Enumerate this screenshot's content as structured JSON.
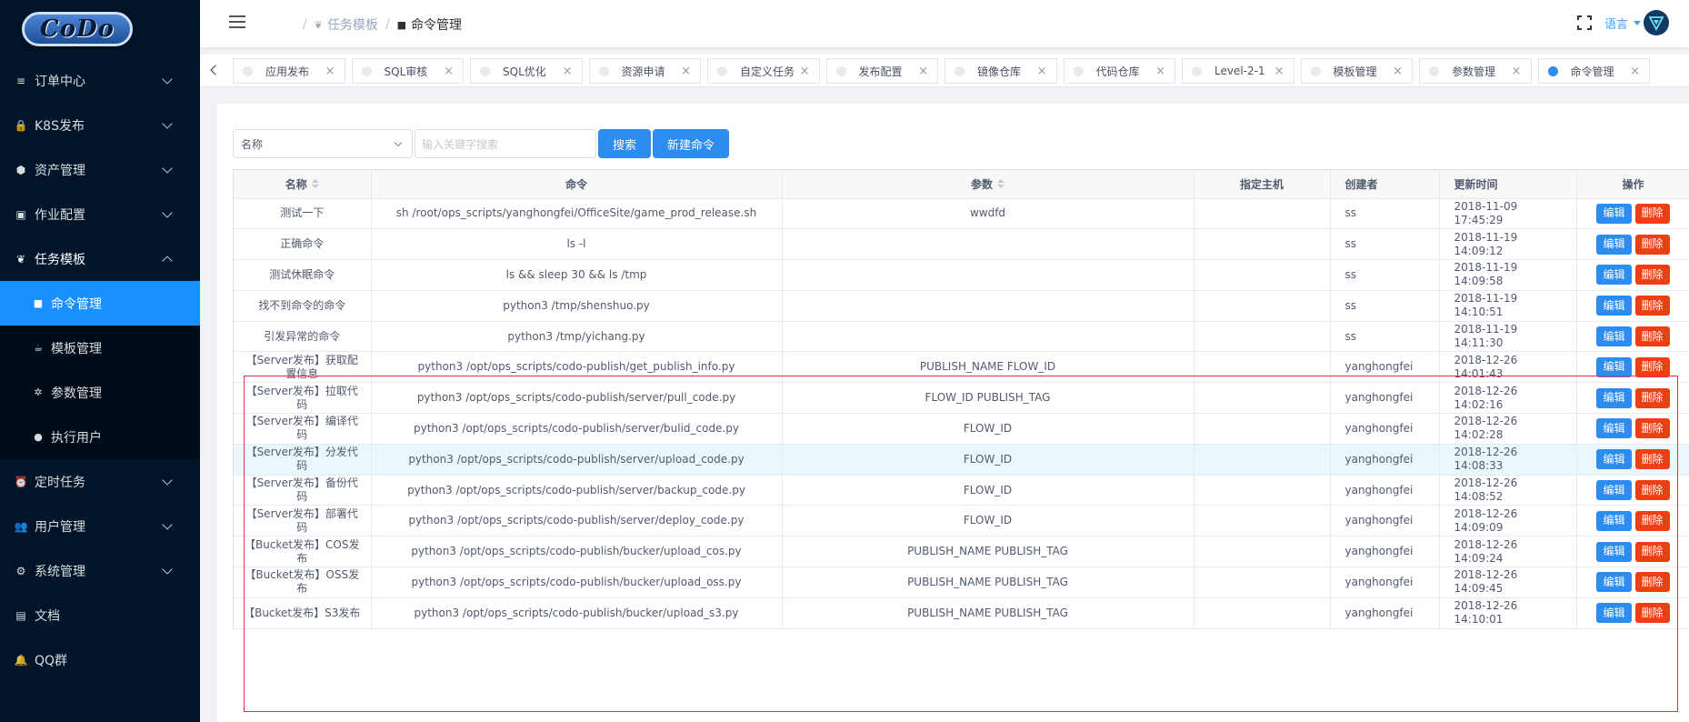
{
  "brand": {
    "logo_text": "CoDo"
  },
  "sidebar": {
    "items": [
      {
        "label": "订单中心",
        "icon": "list-icon",
        "expanded": false
      },
      {
        "label": "K8S发布",
        "icon": "lock-icon",
        "expanded": false
      },
      {
        "label": "资产管理",
        "icon": "cube-icon",
        "expanded": false
      },
      {
        "label": "作业配置",
        "icon": "briefcase-icon",
        "expanded": false
      },
      {
        "label": "任务模板",
        "icon": "leaf-icon",
        "expanded": true,
        "children": [
          {
            "label": "命令管理",
            "icon": "square-icon",
            "active": true
          },
          {
            "label": "模板管理",
            "icon": "cup-icon",
            "active": false
          },
          {
            "label": "参数管理",
            "icon": "asterisk-icon",
            "active": false
          },
          {
            "label": "执行用户",
            "icon": "user-circle-icon",
            "active": false
          }
        ]
      },
      {
        "label": "定时任务",
        "icon": "alarm-icon",
        "expanded": false
      },
      {
        "label": "用户管理",
        "icon": "users-icon",
        "expanded": false
      },
      {
        "label": "系统管理",
        "icon": "gear-icon",
        "expanded": false
      },
      {
        "label": "文档",
        "icon": "book-icon",
        "expanded": null
      },
      {
        "label": "QQ群",
        "icon": "bell-icon",
        "expanded": null
      }
    ]
  },
  "header": {
    "breadcrumb": {
      "parent": "任务模板",
      "current": "命令管理"
    },
    "language": "语言",
    "accent_color": "#409eff"
  },
  "tabs": [
    {
      "label": "应用发布",
      "active": false
    },
    {
      "label": "SQL审核",
      "active": false
    },
    {
      "label": "SQL优化",
      "active": false
    },
    {
      "label": "资源申请",
      "active": false
    },
    {
      "label": "自定义任务",
      "active": false
    },
    {
      "label": "发布配置",
      "active": false
    },
    {
      "label": "镜像仓库",
      "active": false
    },
    {
      "label": "代码仓库",
      "active": false
    },
    {
      "label": "Level-2-1",
      "active": false
    },
    {
      "label": "模板管理",
      "active": false
    },
    {
      "label": "参数管理",
      "active": false
    },
    {
      "label": "命令管理",
      "active": true
    }
  ],
  "toolbar": {
    "filter_select": "名称",
    "search_placeholder": "输入关键字搜索",
    "search_button": "搜索",
    "new_button": "新建命令"
  },
  "table": {
    "columns": [
      "名称",
      "命令",
      "参数",
      "指定主机",
      "创建者",
      "更新时间",
      "操作"
    ],
    "edit_label": "编辑",
    "delete_label": "删除",
    "rows": [
      {
        "name": "测试一下",
        "command": "sh /root/ops_scripts/yanghongfei/OfficeSite/game_prod_release.sh",
        "params": "wwdfd",
        "host": "",
        "creator": "ss",
        "updated": "2018-11-09 17:45:29"
      },
      {
        "name": "正确命令",
        "command": "ls -l",
        "params": "",
        "host": "",
        "creator": "ss",
        "updated": "2018-11-19 14:09:12"
      },
      {
        "name": "测试休眠命令",
        "command": "ls && sleep 30 && ls /tmp",
        "params": "",
        "host": "",
        "creator": "ss",
        "updated": "2018-11-19 14:09:58"
      },
      {
        "name": "找不到命令的命令",
        "command": "python3 /tmp/shenshuo.py",
        "params": "",
        "host": "",
        "creator": "ss",
        "updated": "2018-11-19 14:10:51"
      },
      {
        "name": "引发异常的命令",
        "command": "python3 /tmp/yichang.py",
        "params": "",
        "host": "",
        "creator": "ss",
        "updated": "2018-11-19 14:11:30"
      },
      {
        "name": "【Server发布】获取配置信息",
        "command": "python3 /opt/ops_scripts/codo-publish/get_publish_info.py",
        "params": "PUBLISH_NAME FLOW_ID",
        "host": "",
        "creator": "yanghongfei",
        "updated": "2018-12-26 14:01:43"
      },
      {
        "name": "【Server发布】拉取代码",
        "command": "python3 /opt/ops_scripts/codo-publish/server/pull_code.py",
        "params": "FLOW_ID PUBLISH_TAG",
        "host": "",
        "creator": "yanghongfei",
        "updated": "2018-12-26 14:02:16"
      },
      {
        "name": "【Server发布】编译代码",
        "command": "python3 /opt/ops_scripts/codo-publish/server/bulid_code.py",
        "params": "FLOW_ID",
        "host": "",
        "creator": "yanghongfei",
        "updated": "2018-12-26 14:02:28"
      },
      {
        "name": "【Server发布】分发代码",
        "command": "python3 /opt/ops_scripts/codo-publish/server/upload_code.py",
        "params": "FLOW_ID",
        "host": "",
        "creator": "yanghongfei",
        "updated": "2018-12-26 14:08:33",
        "hover": true
      },
      {
        "name": "【Server发布】备份代码",
        "command": "python3 /opt/ops_scripts/codo-publish/server/backup_code.py",
        "params": "FLOW_ID",
        "host": "",
        "creator": "yanghongfei",
        "updated": "2018-12-26 14:08:52"
      },
      {
        "name": "【Server发布】部署代码",
        "command": "python3 /opt/ops_scripts/codo-publish/server/deploy_code.py",
        "params": "FLOW_ID",
        "host": "",
        "creator": "yanghongfei",
        "updated": "2018-12-26 14:09:09"
      },
      {
        "name": "【Bucket发布】COS发布",
        "command": "python3 /opt/ops_scripts/codo-publish/bucker/upload_cos.py",
        "params": "PUBLISH_NAME PUBLISH_TAG",
        "host": "",
        "creator": "yanghongfei",
        "updated": "2018-12-26 14:09:24"
      },
      {
        "name": "【Bucket发布】OSS发布",
        "command": "python3 /opt/ops_scripts/codo-publish/bucker/upload_oss.py",
        "params": "PUBLISH_NAME PUBLISH_TAG",
        "host": "",
        "creator": "yanghongfei",
        "updated": "2018-12-26 14:09:45"
      },
      {
        "name": "【Bucket发布】S3发布",
        "command": "python3 /opt/ops_scripts/codo-publish/bucker/upload_s3.py",
        "params": "PUBLISH_NAME PUBLISH_TAG",
        "host": "",
        "creator": "yanghongfei",
        "updated": "2018-12-26 14:10:01"
      }
    ]
  },
  "colors": {
    "primary": "#2d8cf0",
    "danger": "#ed3f14",
    "sidebar_bg": "#001529",
    "highlight_border": "#e3334b"
  }
}
